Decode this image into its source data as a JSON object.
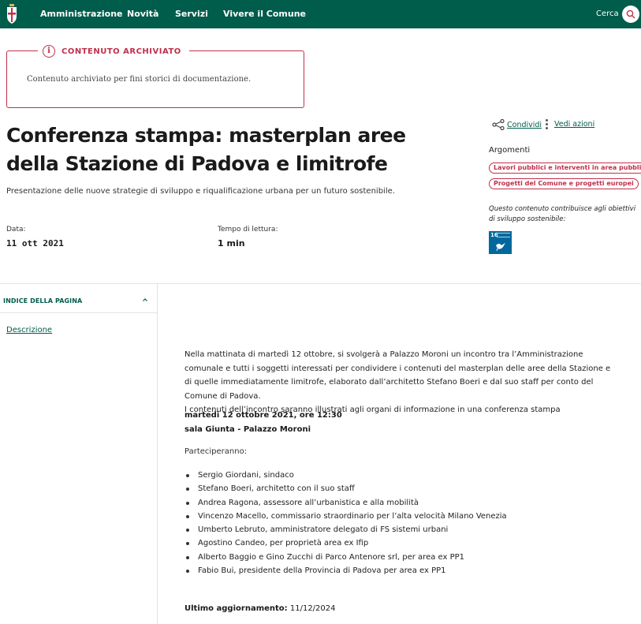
{
  "header": {
    "nav": [
      "Amministrazione",
      "Novità",
      "Servizi",
      "Vivere il Comune"
    ],
    "search_label": "Cerca"
  },
  "archive": {
    "heading": "CONTENUTO ARCHIVIATO",
    "text": "Contenuto archiviato per fini storici di documentazione."
  },
  "article": {
    "title": "Conferenza stampa: masterplan aree della Stazione di Padova e limitrofe",
    "subtitle": "Presentazione delle nuove strategie di sviluppo e riqualificazione urbana per un futuro sostenibile.",
    "date_label": "Data:",
    "date_value": "11 ott 2021",
    "reading_label": "Tempo di lettura:",
    "reading_value": "1 min"
  },
  "aside": {
    "share_label": "Condividi",
    "actions_label": "Vedi azioni",
    "topics_label": "Argomenti",
    "topics": [
      "Lavori pubblici e interventi in area pubblica",
      "Progetti del Comune e progetti europei"
    ],
    "sdg_note": "Questo contenuto contribuisce agli obiettivi di sviluppo sostenibile:",
    "sdg_number": "16",
    "icons": {
      "share": "share-icon",
      "actions": "vertical-dots-icon",
      "search": "search-icon",
      "info": "info-icon"
    }
  },
  "toc": {
    "heading": "INDICE DELLA PAGINA",
    "items": [
      "Descrizione"
    ]
  },
  "body": {
    "paragraph": "Nella mattinata di martedì 12 ottobre, si svolgerà a Palazzo Moroni un incontro tra l’Amministrazione comunale e tutti i soggetti interessati per condividere i contenuti del masterplan delle aree della Stazione e di quelle immediatamente limitrofe, elaborato dall’architetto Stefano Boeri e dal suo staff per conto del Comune di Padova.",
    "paragraph2": "I contenuti dell’incontro saranno illustrati agli organi di informazione in una conferenza stampa",
    "event_time": "martedì 12 ottobre 2021, ore 12:30",
    "event_place": "sala Giunta - Palazzo Moroni",
    "participants_label": "Parteciperanno:",
    "participants": [
      "Sergio Giordani, sindaco",
      "Stefano Boeri, architetto con il suo staff",
      "Andrea Ragona, assessore all’urbanistica e alla mobilità",
      "Vincenzo Macello, commissario straordinario per l’alta velocità Milano Venezia",
      "Umberto Lebruto, amministratore delegato di FS sistemi urbani",
      "Agostino Candeo, per proprietà area ex Ifip",
      "Alberto Baggio e Gino Zucchi di Parco Antenore srl, per area ex PP1",
      "Fabio Bui, presidente della Provincia di Padova per area ex PP1"
    ],
    "last_update_label": "Ultimo aggiornamento:",
    "last_update_value": "11/12/2024"
  },
  "colors": {
    "brand": "#005c4b",
    "accent": "#c0304a",
    "sdg": "#00689d"
  }
}
